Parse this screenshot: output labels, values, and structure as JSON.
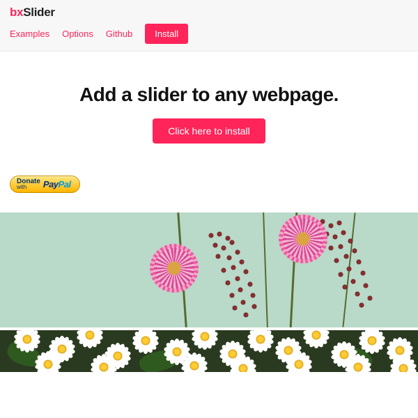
{
  "logo": {
    "prefix": "bx",
    "suffix": "Slider"
  },
  "nav": {
    "examples": "Examples",
    "options": "Options",
    "github": "Github",
    "install": "Install"
  },
  "hero": {
    "headline": "Add a slider to any webpage.",
    "cta": "Click here to install"
  },
  "donate": {
    "line1": "Donate",
    "line2": "with",
    "brand_pay": "Pay",
    "brand_pal": "Pal"
  },
  "colors": {
    "accent": "#ff2459",
    "header_bg": "#f7f7f7"
  }
}
